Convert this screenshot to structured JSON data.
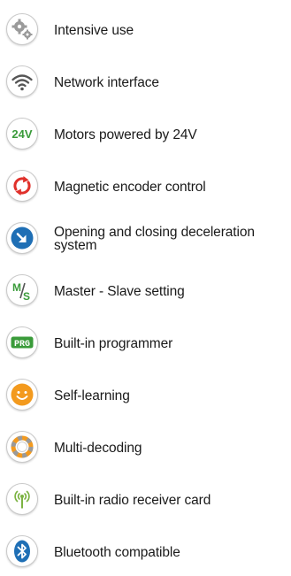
{
  "features": [
    {
      "icon": "gears-icon",
      "label": "Intensive use"
    },
    {
      "icon": "wifi-icon",
      "label": "Network interface"
    },
    {
      "icon": "24v-icon",
      "label": "Motors powered by 24V",
      "icon_text": "24V",
      "icon_color": "#3a9b3a"
    },
    {
      "icon": "encoder-arrows-icon",
      "label": "Magnetic encoder control",
      "icon_color": "#e0302a"
    },
    {
      "icon": "deceleration-icon",
      "label": "Opening and closing deceleration system",
      "icon_color": "#1f6fb5"
    },
    {
      "icon": "master-slave-icon",
      "label": "Master - Slave setting",
      "icon_text_a": "M",
      "icon_text_b": "S",
      "icon_color": "#3a9b3a"
    },
    {
      "icon": "programmer-icon",
      "label": "Built-in programmer",
      "icon_text": "PRG",
      "icon_color": "#3a9b3a"
    },
    {
      "icon": "smiley-icon",
      "label": "Self-learning",
      "icon_color": "#f39a1e"
    },
    {
      "icon": "multi-decoding-icon",
      "label": "Multi-decoding",
      "icon_color": "#f39a1e"
    },
    {
      "icon": "antenna-icon",
      "label": "Built-in radio receiver card",
      "icon_color": "#7cb342"
    },
    {
      "icon": "bluetooth-icon",
      "label": "Bluetooth compatible",
      "icon_color": "#1f6fb5"
    }
  ]
}
